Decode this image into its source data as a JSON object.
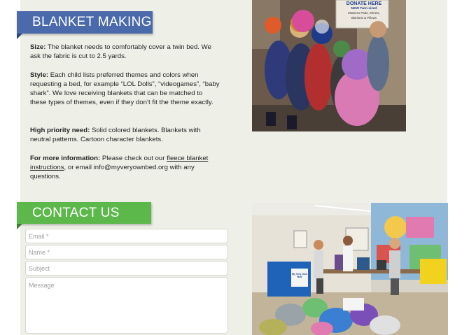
{
  "blanket": {
    "title": "BLANKET MAKING",
    "size_label": "Size:",
    "size_text": " The blanket needs to comfortably cover a twin bed. We ask the fabric is cut to 2.5 yards.",
    "style_label": "Style:",
    "style_text": " Each child lists preferred themes and colors when requesting a bed, for example “LOL Dolls”, “videogames”, “baby shark”. We love receiving blankets that can be matched to these types of themes, even if they don’t fit the theme exactly.",
    "priority_label": "High priority need:",
    "priority_text": " Solid colored blankets. Blankets with neutral patterns. Cartoon character blankets.",
    "info_label": "For more information:",
    "info_text_before": " Please check out our ",
    "info_link": "fleece blanket instructions",
    "info_text_after": ", or email info@myveryownbed.org with any questions."
  },
  "contact": {
    "title": "CONTACT US",
    "email_placeholder": "Email *",
    "name_placeholder": "Name *",
    "subject_placeholder": "Subject",
    "message_placeholder": "Message"
  },
  "photo1": {
    "sign_line1": "DONATE HERE",
    "sign_line2": "NEW Twin-sized",
    "sign_line3": "Mattress Pads, Sheets,",
    "sign_line4": "Blankets & Pillows"
  },
  "photo2": {
    "box_text": "My Very Own Bed"
  },
  "colors": {
    "blanket_ribbon": "#4b6aab",
    "contact_ribbon": "#5cb84b",
    "panel_bg": "#eef0e8"
  }
}
